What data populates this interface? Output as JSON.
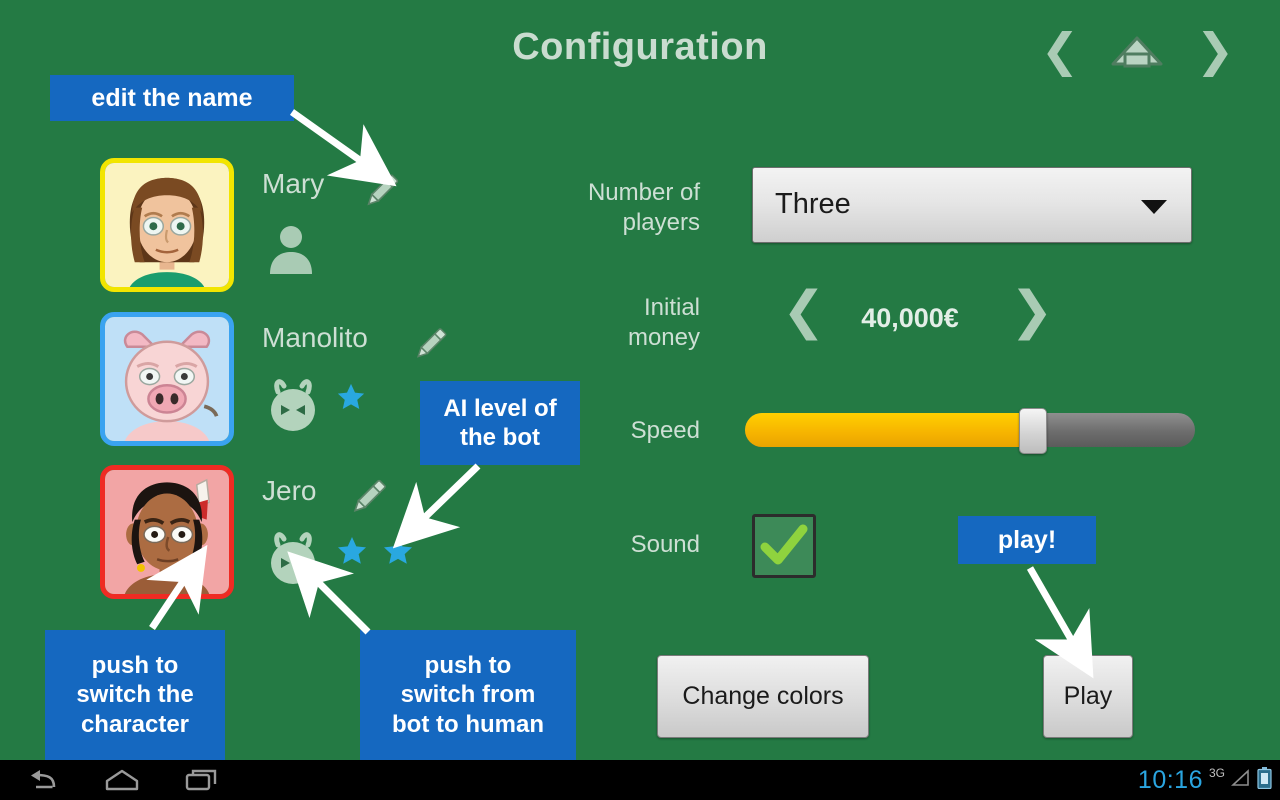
{
  "header": {
    "title": "Configuration",
    "nav": {
      "prev_icon": "chevron-left-icon",
      "home_icon": "home-icon",
      "next_icon": "chevron-right-icon",
      "prev_glyph": "❮",
      "next_glyph": "❯"
    }
  },
  "players": [
    {
      "name": "Mary",
      "frame_color": "#f2e500",
      "avatar_bg": "#fbf3c0",
      "avatar_icon": "woman-avatar",
      "type": "human",
      "type_icon": "person-icon",
      "edit_icon": "pencil-icon",
      "ai_stars": 0
    },
    {
      "name": "Manolito",
      "frame_color": "#3aa3f0",
      "avatar_bg": "#bfe0f7",
      "avatar_icon": "pig-avatar",
      "type": "bot",
      "type_icon": "robot-icon",
      "edit_icon": "pencil-icon",
      "ai_stars": 1
    },
    {
      "name": "Jero",
      "frame_color": "#ef2b23",
      "avatar_bg": "#f2a5a5",
      "avatar_icon": "native-man-avatar",
      "type": "bot",
      "type_icon": "robot-icon",
      "edit_icon": "pencil-icon",
      "ai_stars": 2
    }
  ],
  "settings": {
    "players_label": "Number of\nplayers",
    "players_label_line1": "Number of",
    "players_label_line2": "players",
    "players_value": "Three",
    "players_caret_icon": "chevron-down-icon",
    "money_label_line1": "Initial",
    "money_label_line2": "money",
    "money_value": "40,000€",
    "money_dec_icon": "chevron-left-icon",
    "money_inc_icon": "chevron-right-icon",
    "money_dec_glyph": "❮",
    "money_inc_glyph": "❯",
    "speed_label": "Speed",
    "speed_percent": 64,
    "sound_label": "Sound",
    "sound_checked": true,
    "sound_check_icon": "checkmark-icon"
  },
  "buttons": {
    "change_colors": "Change colors",
    "play": "Play"
  },
  "callouts": {
    "edit_name": "edit the name",
    "ai_level": "AI level of the bot",
    "ai_level_line1": "AI level of",
    "ai_level_line2": "the bot",
    "switch_character": "push to switch the character",
    "switch_character_line1": "push to",
    "switch_character_line2": "switch the",
    "switch_character_line3": "character",
    "switch_bot": "push to switch from bot to human",
    "switch_bot_line1": "push to",
    "switch_bot_line2": "switch from",
    "switch_bot_line3": "bot to human",
    "play": "play!"
  },
  "statusbar": {
    "back_icon": "back-icon",
    "home_icon": "home-icon",
    "recents_icon": "recent-apps-icon",
    "clock": "10:16",
    "network": "3G",
    "signal_icon": "signal-icon",
    "battery_icon": "battery-icon"
  },
  "colors": {
    "background_green": "#247a44",
    "callout_blue": "#1568c0",
    "star_blue": "#29a8e0",
    "slider_yellow": "#f6b300",
    "label_text": "#cddfd4"
  }
}
